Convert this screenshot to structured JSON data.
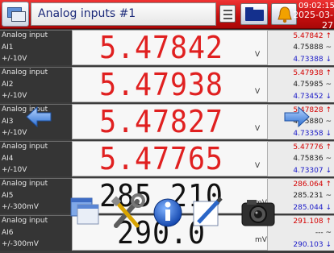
{
  "header": {
    "title": "Analog inputs #1",
    "time": "09:02:15",
    "date": "2025-03-27"
  },
  "colors": {
    "header_red": "#c40e0e",
    "value_red": "#e02020",
    "value_black": "#111111",
    "min_red": "#d40000",
    "max_blue": "#1a1ac8"
  },
  "icons": {
    "window": "window-switch-icon",
    "list": "list-icon",
    "folder": "folder-icon",
    "alarm": "alarm-bell-icon",
    "nav_left": "arrow-left-icon",
    "nav_right": "arrow-right-icon",
    "toolbar": [
      "windows-icon",
      "tools-icon",
      "info-icon",
      "edit-icon",
      "camera-icon"
    ]
  },
  "rows": [
    {
      "type": "Analog input",
      "name": "AI1",
      "range": "+/-10V",
      "value": "5.47842",
      "unit": "V",
      "color": "#e02020",
      "max": "5.47842 ↑",
      "avg": "4.75888 ~",
      "min": "4.73388 ↓"
    },
    {
      "type": "Analog input",
      "name": "AI2",
      "range": "+/-10V",
      "value": "5.47938",
      "unit": "V",
      "color": "#e02020",
      "max": "5.47938 ↑",
      "avg": "4.75985 ~",
      "min": "4.73452 ↓"
    },
    {
      "type": "Analog input",
      "name": "AI3",
      "range": "+/-10V",
      "value": "5.47827",
      "unit": "V",
      "color": "#e02020",
      "max": "5.47828 ↑",
      "avg": "4.75880 ~",
      "min": "4.73358 ↓"
    },
    {
      "type": "Analog input",
      "name": "AI4",
      "range": "+/-10V",
      "value": "5.47765",
      "unit": "V",
      "color": "#e02020",
      "max": "5.47776 ↑",
      "avg": "4.75836 ~",
      "min": "4.73307 ↓"
    },
    {
      "type": "Analog input",
      "name": "AI5",
      "range": "+/-300mV",
      "value": "285.210",
      "unit": "mV",
      "color": "#111111",
      "max": "286.064 ↑",
      "avg": "285.231 ~",
      "min": "285.044 ↓"
    },
    {
      "type": "Analog input",
      "name": "AI6",
      "range": "+/-300mV",
      "value": "290.0",
      "unit": "mV",
      "color": "#111111",
      "max": "291.108 ↑",
      "avg": "--- ~",
      "min": "290.103 ↓"
    }
  ]
}
